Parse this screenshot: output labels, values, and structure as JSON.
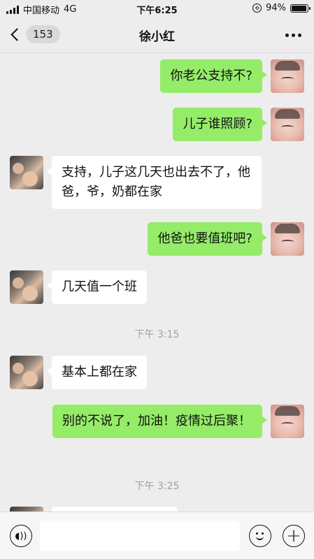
{
  "status_bar": {
    "carrier": "中国移动",
    "network": "4G",
    "time": "下午6:25",
    "battery_percent": "94%",
    "battery_level": 0.94
  },
  "nav": {
    "unread_count": "153",
    "title": "徐小红"
  },
  "messages": [
    {
      "side": "right",
      "text": "你老公支持不?"
    },
    {
      "side": "right",
      "text": "儿子谁照顾?"
    },
    {
      "side": "left",
      "text": "支持，儿子这几天也出去不了，他爸，爷，奶都在家"
    },
    {
      "side": "right",
      "text": "他爸也要值班吧?"
    },
    {
      "side": "left",
      "text": "几天值一个班"
    },
    {
      "type": "timestamp",
      "text": "下午 3:15"
    },
    {
      "side": "left",
      "text": "基本上都在家"
    },
    {
      "side": "right",
      "text": "别的不说了，加油！疫情过后聚！"
    },
    {
      "type": "timestamp",
      "text": "下午 3:25"
    }
  ],
  "input": {
    "placeholder": ""
  },
  "colors": {
    "my_bubble": "#95ec69",
    "their_bubble": "#ffffff",
    "background": "#ededed"
  }
}
